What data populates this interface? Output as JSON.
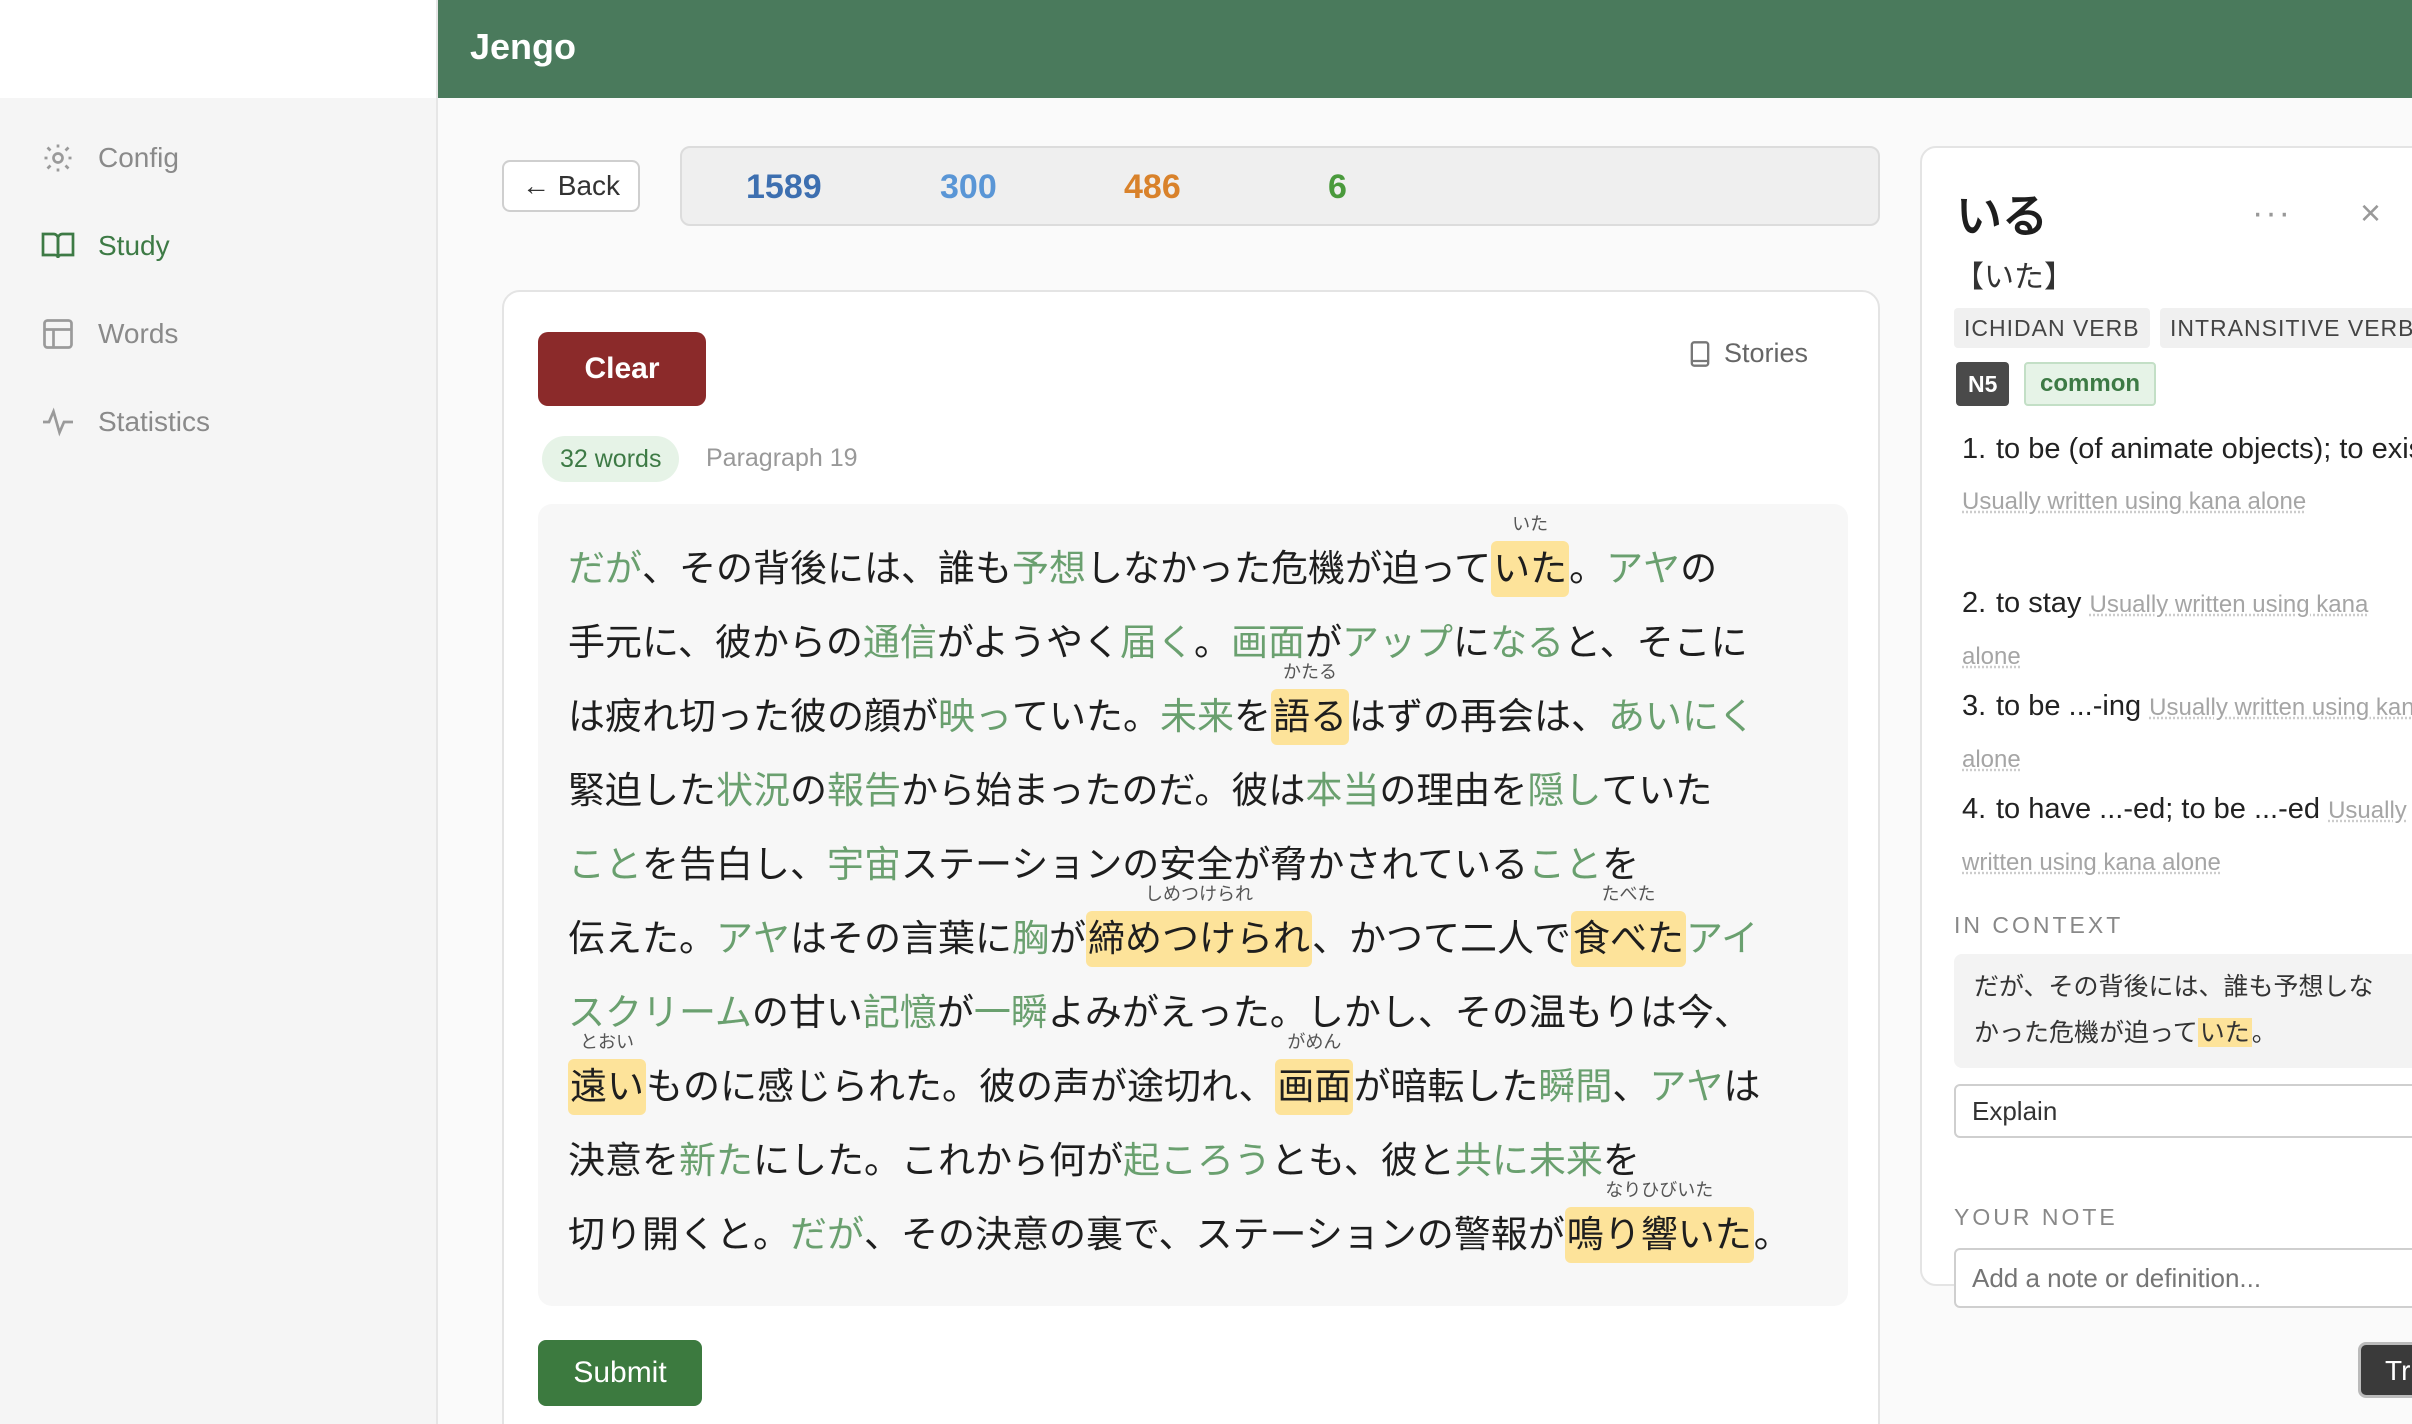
{
  "app": {
    "title": "Jengo"
  },
  "sidebar": {
    "items": [
      {
        "label": "Config",
        "icon": "config-icon",
        "active": false
      },
      {
        "label": "Study",
        "icon": "book-icon",
        "active": true
      },
      {
        "label": "Words",
        "icon": "layout-icon",
        "active": false
      },
      {
        "label": "Statistics",
        "icon": "activity-icon",
        "active": false
      }
    ]
  },
  "toolbar": {
    "back_label": "← Back",
    "stats": [
      {
        "value": "1589",
        "color": "#3d6fb0"
      },
      {
        "value": "300",
        "color": "#5a96d6"
      },
      {
        "value": "486",
        "color": "#d9822b"
      },
      {
        "value": "6",
        "color": "#4a9a3c"
      }
    ]
  },
  "study": {
    "clear_label": "Clear",
    "stories_label": "Stories",
    "words_count": "32 words",
    "paragraph_label": "Paragraph 19",
    "submit_label": "Submit",
    "lines": [
      [
        {
          "t": "だが",
          "k": true
        },
        {
          "t": "、その背後には、誰も"
        },
        {
          "t": "予想",
          "k": true
        },
        {
          "t": "しなかった危機が迫って"
        },
        {
          "t": "いた",
          "sel": true,
          "f": "いた"
        },
        {
          "t": "。"
        },
        {
          "t": "アヤ",
          "k": true
        },
        {
          "t": "の"
        }
      ],
      [
        {
          "t": "手元に、彼からの"
        },
        {
          "t": "通信",
          "k": true
        },
        {
          "t": "がようやく"
        },
        {
          "t": "届く",
          "k": true
        },
        {
          "t": "。"
        },
        {
          "t": "画面",
          "k": true
        },
        {
          "t": "が"
        },
        {
          "t": "アップ",
          "k": true
        },
        {
          "t": "に"
        },
        {
          "t": "なる",
          "k": true
        },
        {
          "t": "と、そこに"
        }
      ],
      [
        {
          "t": "は疲れ切った彼の顔が"
        },
        {
          "t": "映っ",
          "k": true
        },
        {
          "t": "ていた。"
        },
        {
          "t": "未来",
          "k": true
        },
        {
          "t": "を"
        },
        {
          "t": "語る",
          "sel": true,
          "f": "かたる"
        },
        {
          "t": "はずの再会は、"
        },
        {
          "t": "あいにく",
          "k": true
        }
      ],
      [
        {
          "t": "緊迫した"
        },
        {
          "t": "状況",
          "k": true
        },
        {
          "t": "の"
        },
        {
          "t": "報告",
          "k": true
        },
        {
          "t": "から始まったのだ。彼は"
        },
        {
          "t": "本当",
          "k": true
        },
        {
          "t": "の理由を"
        },
        {
          "t": "隠し",
          "k": true
        },
        {
          "t": "ていた"
        }
      ],
      [
        {
          "t": "こと",
          "k": true
        },
        {
          "t": "を告白し、"
        },
        {
          "t": "宇宙",
          "k": true
        },
        {
          "t": "ステーションの安全が脅かされている"
        },
        {
          "t": "こと",
          "k": true
        },
        {
          "t": "を"
        }
      ],
      [
        {
          "t": "伝えた。"
        },
        {
          "t": "アヤ",
          "k": true
        },
        {
          "t": "はその言葉に"
        },
        {
          "t": "胸",
          "k": true
        },
        {
          "t": "が"
        },
        {
          "t": "締めつけられ",
          "sel": true,
          "f": "しめつけられ"
        },
        {
          "t": "、かつて二人で"
        },
        {
          "t": "食べた",
          "sel": true,
          "f": "たべた"
        },
        {
          "t": "アイ",
          "k": true
        }
      ],
      [
        {
          "t": "スクリーム",
          "k": true
        },
        {
          "t": "の甘い"
        },
        {
          "t": "記憶",
          "k": true
        },
        {
          "t": "が"
        },
        {
          "t": "一瞬",
          "k": true
        },
        {
          "t": "よみがえった。しかし、その温もりは今、"
        }
      ],
      [
        {
          "t": "遠い",
          "sel": true,
          "f": "とおい"
        },
        {
          "t": "ものに感じられた。彼の声が途切れ、"
        },
        {
          "t": "画面",
          "sel": true,
          "f": "がめん"
        },
        {
          "t": "が暗転した"
        },
        {
          "t": "瞬間",
          "k": true
        },
        {
          "t": "、"
        },
        {
          "t": "アヤ",
          "k": true
        },
        {
          "t": "は"
        }
      ],
      [
        {
          "t": "決意を"
        },
        {
          "t": "新た",
          "k": true
        },
        {
          "t": "にした。これから何が"
        },
        {
          "t": "起ころう",
          "k": true
        },
        {
          "t": "とも、彼と"
        },
        {
          "t": "共に",
          "k": true
        },
        {
          "t": "未来",
          "k": true
        },
        {
          "t": "を"
        }
      ],
      [
        {
          "t": "切り開くと。"
        },
        {
          "t": "だが",
          "k": true
        },
        {
          "t": "、その決意の裏で、ステーションの警報が"
        },
        {
          "t": "鳴り響いた",
          "sel": true,
          "f": "なりひびいた"
        },
        {
          "t": "。"
        }
      ]
    ]
  },
  "dictionary": {
    "word": "いる",
    "more_label": "···",
    "close_label": "×",
    "reading": "【いた】",
    "pos_tags": [
      "ICHIDAN VERB",
      "INTRANSITIVE VERB"
    ],
    "jlpt": "N5",
    "common": "common",
    "definitions": [
      {
        "num": "1.",
        "text": "to be (of animate objects); to exist",
        "note": "Usually written using kana alone"
      },
      {
        "num": "2.",
        "text": "to stay",
        "note": "Usually written using kana alone"
      },
      {
        "num": "3.",
        "text": "to be ...-ing",
        "note": "Usually written using kana alone"
      },
      {
        "num": "4.",
        "text": "to have ...-ed; to be ...-ed",
        "note": "Usually written using kana alone"
      }
    ],
    "context_label": "IN CONTEXT",
    "context_before": "だが、その背後には、誰も予想しな",
    "context_line2": "かった危機が迫って",
    "context_highlight": "いた",
    "context_after": "。",
    "explain_value": "Explain",
    "note_label": "YOUR NOTE",
    "note_placeholder": "Add a note or definition..."
  },
  "floating": {
    "tr_label": "Tr"
  }
}
